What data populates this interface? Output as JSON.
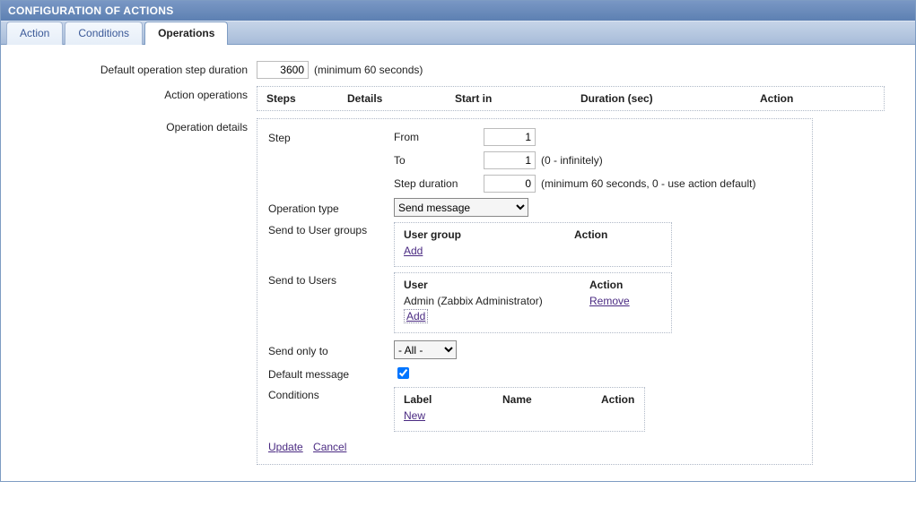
{
  "panel_title": "CONFIGURATION OF ACTIONS",
  "tabs": {
    "action": "Action",
    "conditions": "Conditions",
    "operations": "Operations"
  },
  "form": {
    "default_step_duration_label": "Default operation step duration",
    "default_step_duration_value": "3600",
    "default_step_duration_hint": "(minimum 60 seconds)",
    "action_operations_label": "Action operations",
    "action_ops_headers": {
      "steps": "Steps",
      "details": "Details",
      "start_in": "Start in",
      "duration": "Duration (sec)",
      "action": "Action"
    },
    "operation_details_label": "Operation details"
  },
  "details": {
    "step_label": "Step",
    "from_label": "From",
    "from_value": "1",
    "to_label": "To",
    "to_value": "1",
    "to_hint": "(0 - infinitely)",
    "step_duration_label": "Step duration",
    "step_duration_value": "0",
    "step_duration_hint": "(minimum 60 seconds, 0 - use action default)",
    "operation_type_label": "Operation type",
    "operation_type_value": "Send message",
    "send_user_groups_label": "Send to User groups",
    "user_group_col": "User group",
    "action_col": "Action",
    "add_link": "Add",
    "send_users_label": "Send to Users",
    "user_col": "User",
    "user_row_name": "Admin (Zabbix Administrator)",
    "remove_link": "Remove",
    "send_only_to_label": "Send only to",
    "send_only_to_value": "- All -",
    "default_message_label": "Default message",
    "conditions_label": "Conditions",
    "cond_label_col": "Label",
    "cond_name_col": "Name",
    "cond_action_col": "Action",
    "new_link": "New",
    "update_link": "Update",
    "cancel_link": "Cancel"
  }
}
